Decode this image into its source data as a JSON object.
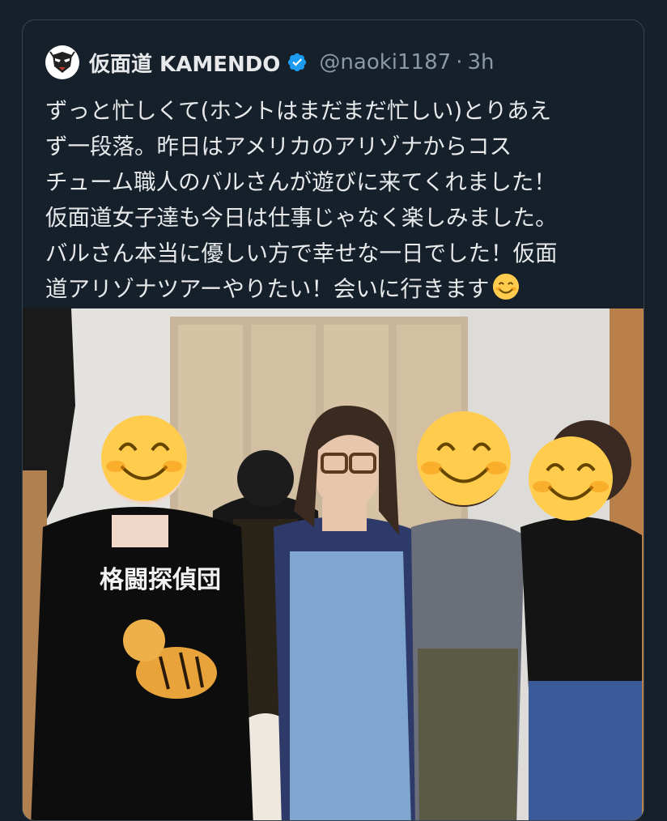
{
  "tweet": {
    "display_name": "仮面道 KAMENDO",
    "handle": "@naoki1187",
    "separator": "·",
    "time": "3h",
    "text_lines": [
      "ずっと忙しくて(ホントはまだまだ忙しい)とりあえ",
      "ず一段落。昨日はアメリカのアリゾナからコス",
      "チューム職人のバルさんが遊びに来てくれました！",
      "仮面道女子達も今日は仕事じゃなく楽しみました。",
      "バルさん本当に優しい方で幸せな一日でした！仮面",
      "道アリゾナツアーやりたい！会いに行きます"
    ]
  },
  "photo": {
    "shirt_text": "格闘探偵団"
  },
  "colors": {
    "background": "#15202b",
    "border": "#38444d",
    "text": "#e7e9ea",
    "muted": "#8b98a5",
    "verified": "#1d9bf0",
    "emoji": "#ffcc4d"
  },
  "icons": {
    "avatar": "kamendo-mask-logo",
    "verified": "verified-badge-icon",
    "emoji": "smiling-face-emoji"
  }
}
